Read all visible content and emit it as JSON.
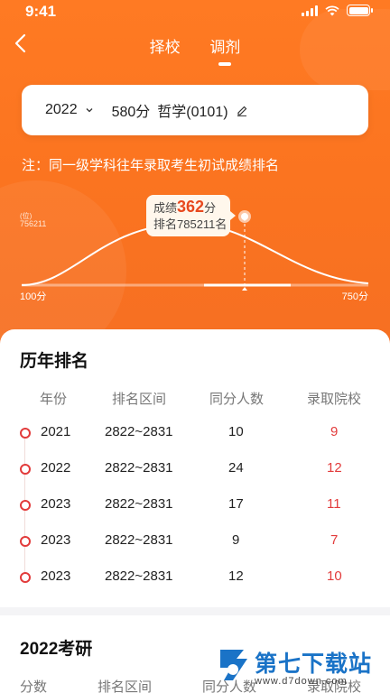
{
  "status_bar": {
    "time": "9:41"
  },
  "nav": {
    "tabs": [
      {
        "label": "择校"
      },
      {
        "label": "调剂",
        "active": true
      }
    ]
  },
  "search": {
    "year": "2022",
    "score": "580分",
    "subject": "哲学(0101)"
  },
  "note": "注：同一级学科往年录取考生初试成绩排名",
  "distribution": {
    "axis_unit": "(位)",
    "axis_max": "756211",
    "min_label": "100分",
    "max_label": "750分",
    "tooltip": {
      "score_prefix": "成绩",
      "score_value": "362",
      "score_suffix": "分",
      "rank_line": "排名785211名"
    }
  },
  "history": {
    "title": "历年排名",
    "columns": [
      "年份",
      "排名区间",
      "同分人数",
      "录取院校"
    ],
    "rows": [
      {
        "year": "2021",
        "range": "2822~2831",
        "same": "10",
        "schools": "9"
      },
      {
        "year": "2022",
        "range": "2822~2831",
        "same": "24",
        "schools": "12"
      },
      {
        "year": "2023",
        "range": "2822~2831",
        "same": "17",
        "schools": "11"
      },
      {
        "year": "2023",
        "range": "2822~2831",
        "same": "9",
        "schools": "7"
      },
      {
        "year": "2023",
        "range": "2822~2831",
        "same": "12",
        "schools": "10"
      }
    ]
  },
  "exam": {
    "title": "2022考研",
    "columns": [
      "分数",
      "排名区间",
      "同分人数",
      "录取院校"
    ]
  },
  "watermark": {
    "name": "第七下载站",
    "url": "www.d7down.com"
  },
  "colors": {
    "accent": "#fb7420",
    "red": "#e23b3b"
  }
}
